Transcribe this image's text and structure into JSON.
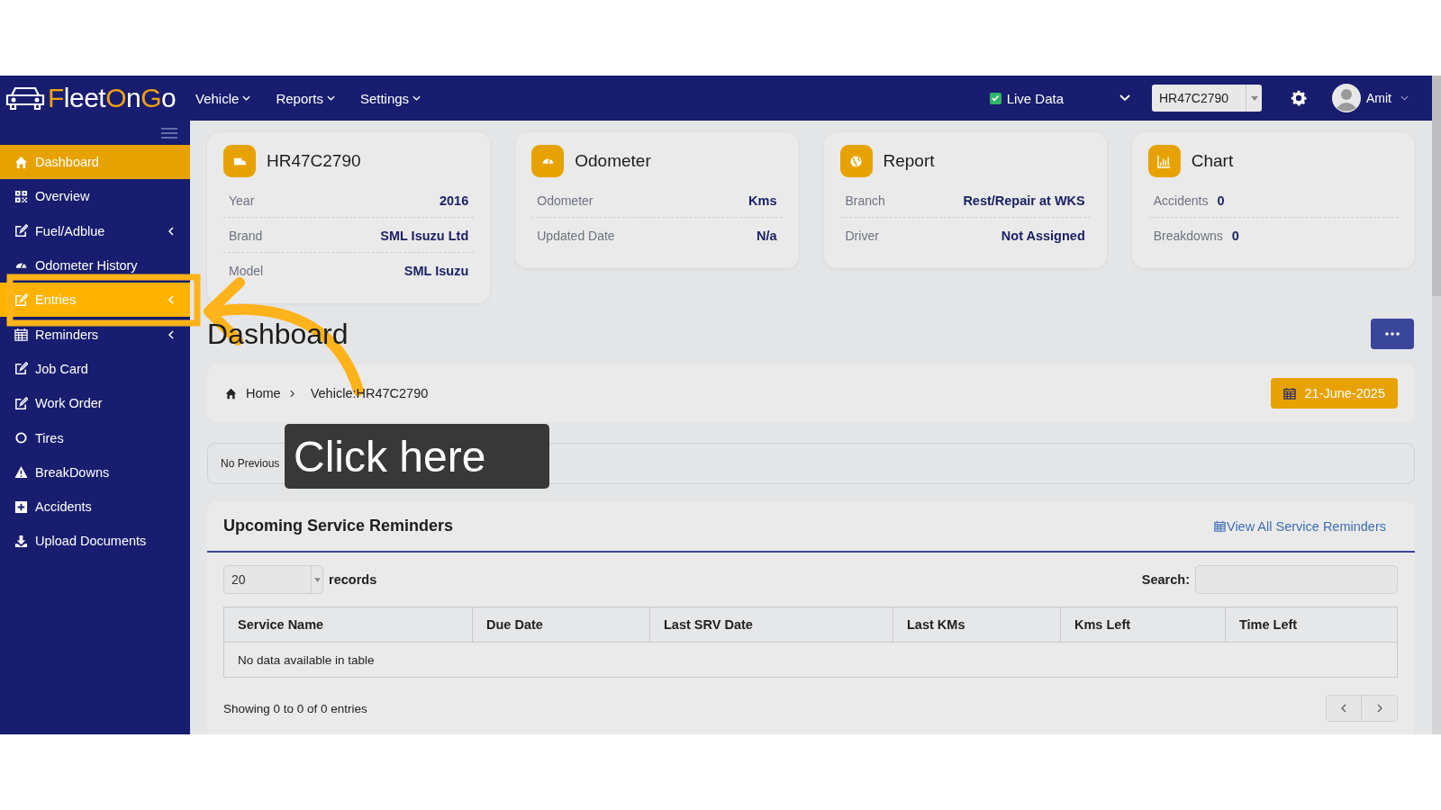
{
  "navbar": {
    "logo": [
      {
        "text": "F",
        "accent": true
      },
      {
        "text": "leet",
        "accent": false
      },
      {
        "text": "O",
        "accent": true
      },
      {
        "text": "n",
        "accent": false
      },
      {
        "text": "G",
        "accent": true
      },
      {
        "text": "o",
        "accent": false
      }
    ],
    "menus": [
      "Vehicle",
      "Reports",
      "Settings"
    ],
    "live_data": {
      "label": "Live Data",
      "checked": true
    },
    "vehicle_select": {
      "value": "HR47C2790"
    },
    "user": {
      "name": "Amit"
    }
  },
  "sidebar": {
    "items": [
      {
        "label": "Dashboard",
        "kind": "home",
        "selected": true,
        "highlighted": false,
        "submenu": false
      },
      {
        "label": "Overview",
        "kind": "qr",
        "selected": false,
        "highlighted": false,
        "submenu": false
      },
      {
        "label": "Fuel/Adblue",
        "kind": "edit",
        "selected": false,
        "highlighted": false,
        "submenu": true
      },
      {
        "label": "Odometer History",
        "kind": "gauge",
        "selected": false,
        "highlighted": false,
        "submenu": false
      },
      {
        "label": "Entries",
        "kind": "edit",
        "selected": false,
        "highlighted": true,
        "submenu": true
      },
      {
        "label": "Reminders",
        "kind": "calendar",
        "selected": false,
        "highlighted": false,
        "submenu": true
      },
      {
        "label": "Job Card",
        "kind": "edit",
        "selected": false,
        "highlighted": false,
        "submenu": false
      },
      {
        "label": "Work Order",
        "kind": "edit",
        "selected": false,
        "highlighted": false,
        "submenu": false
      },
      {
        "label": "Tires",
        "kind": "circle",
        "selected": false,
        "highlighted": false,
        "submenu": false
      },
      {
        "label": "BreakDowns",
        "kind": "warning",
        "selected": false,
        "highlighted": false,
        "submenu": false
      },
      {
        "label": "Accidents",
        "kind": "plus",
        "selected": false,
        "highlighted": false,
        "submenu": false
      },
      {
        "label": "Upload Documents",
        "kind": "download",
        "selected": false,
        "highlighted": false,
        "submenu": false
      }
    ]
  },
  "cards": [
    {
      "title": "HR47C2790",
      "kind": "split",
      "rows": [
        {
          "label": "Year",
          "value": "2016"
        },
        {
          "label": "Brand",
          "value": "SML Isuzu Ltd"
        },
        {
          "label": "Model",
          "value": "SML Isuzu"
        }
      ]
    },
    {
      "title": "Odometer",
      "kind": "split",
      "rows": [
        {
          "label": "Odometer",
          "value": "Kms"
        },
        {
          "label": "Updated Date",
          "value": "N/a"
        }
      ]
    },
    {
      "title": "Report",
      "kind": "split",
      "rows": [
        {
          "label": "Branch",
          "value": "Rest/Repair at WKS"
        },
        {
          "label": "Driver",
          "value": "Not Assigned"
        }
      ]
    },
    {
      "title": "Chart",
      "kind": "inline",
      "rows": [
        {
          "label": "Accidents",
          "value": "0"
        },
        {
          "label": "Breakdowns",
          "value": "0"
        }
      ]
    }
  ],
  "page_title": "Dashboard",
  "breadcrumb": [
    "Home",
    "Vehicle:HR47C2790"
  ],
  "date": "21-June-2025",
  "notice": "No Previous",
  "reminders": {
    "title": "Upcoming Service Reminders",
    "link": "View All Service Reminders",
    "page_length": "20",
    "records_label": "records",
    "search_label": "Search:",
    "columns": [
      "Service Name",
      "Due Date",
      "Last SRV Date",
      "Last KMs",
      "Kms Left",
      "Time Left"
    ],
    "empty": "No data available in table",
    "info": "Showing 0 to 0 of 0 entries"
  },
  "callout": "Click here"
}
